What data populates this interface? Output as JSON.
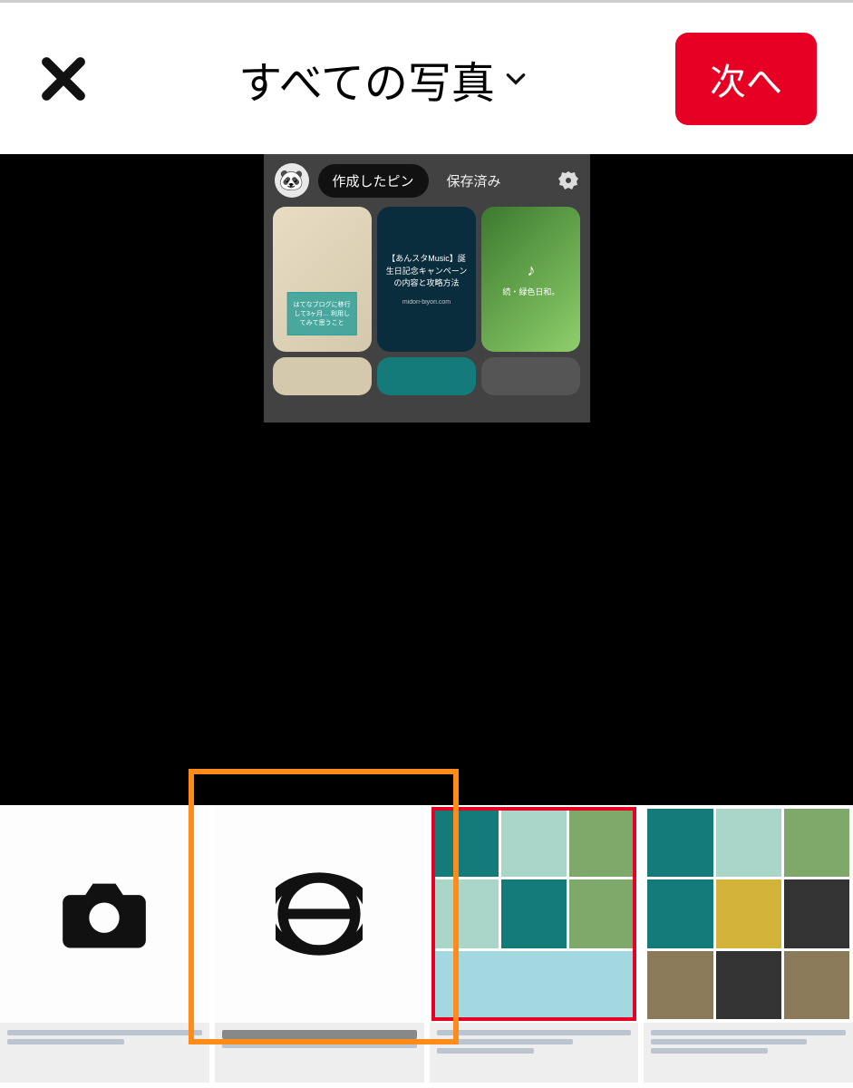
{
  "topbar": {
    "title": "すべての写真",
    "next_label": "次へ"
  },
  "preview": {
    "tab_created": "作成したピン",
    "tab_saved": "保存済み",
    "card1_text": "はてなブログに移行して3ヶ月… 利用してみて思うこと",
    "card2_text": "【あんスタMusic】誕生日記念キャンペーンの内容と攻略方法",
    "card2_sub": "midori-biyori.com",
    "card3_text": "続・緑色日和。"
  },
  "grid": {
    "camera_label": "camera",
    "globe_label": "web"
  }
}
